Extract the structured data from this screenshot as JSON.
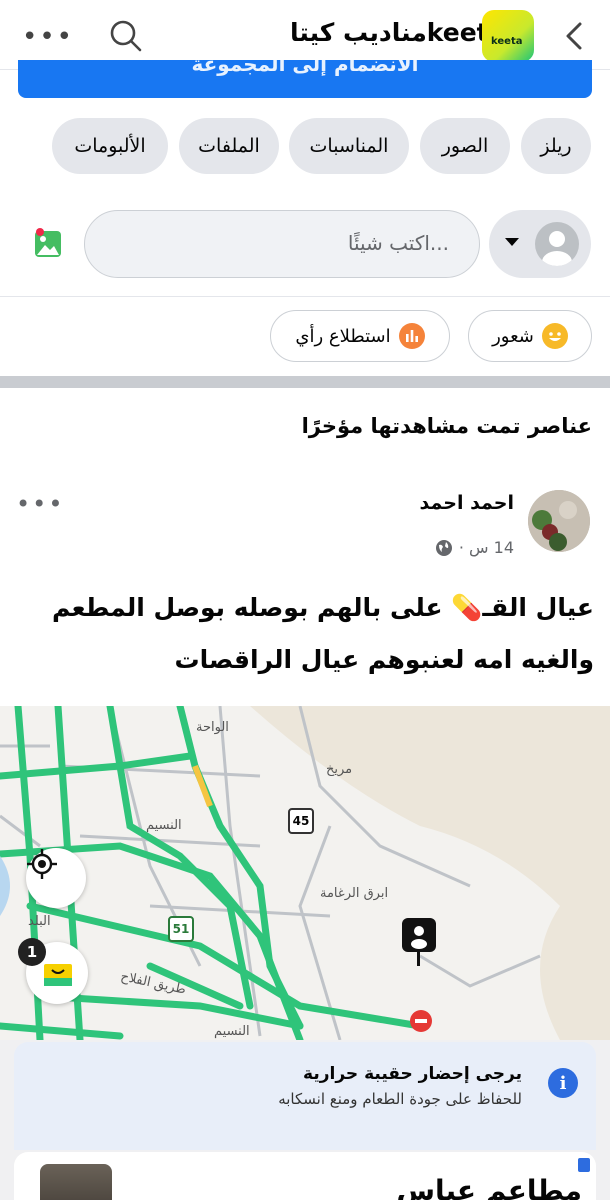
{
  "header": {
    "title": "مناديب كيتاkeeta",
    "logo_text": "keeta",
    "more_icon": "more-horizontal-icon",
    "search_icon": "search-icon",
    "back_icon": "chevron-left-icon"
  },
  "join_button": {
    "label": "الانضمام إلى المجموعة"
  },
  "chips": [
    "ريلز",
    "الصور",
    "المناسبات",
    "الملفات",
    "الألبومات"
  ],
  "composer": {
    "placeholder": "اكتب شيئًا..."
  },
  "actions": {
    "feeling": "شعور",
    "poll": "استطلاع رأي"
  },
  "recent_title": "عناصر تمت مشاهدتها مؤخرًا",
  "post": {
    "author": "احمد احمد",
    "time": "14 س ·",
    "text_line1": "عيال القـ💊 على بالهم بوصله بوصل المطعم",
    "text_line2": "والغيه امه لعنبوهم عيال الراقصات"
  },
  "map": {
    "labels": {
      "waha": "الواحة",
      "mareekh": "مريخ",
      "naseem": "النسيم",
      "ghamah": "ابرق الرغامة",
      "balad": "البلد",
      "fallah": "طريق الفلاح",
      "naseem2": "النسيم"
    },
    "route_45": "45",
    "route_51": "51",
    "cart_badge": "1"
  },
  "notice": {
    "title": "يرجى إحضار حقيبة حرارية",
    "subtitle": "للحفاظ على جودة الطعام ومنع انسكابه"
  },
  "restaurant": {
    "name": "مطاعم عباس"
  },
  "colors": {
    "accent": "#1877f2",
    "road": "#2ecc71",
    "chip_bg": "#e4e6eb"
  }
}
